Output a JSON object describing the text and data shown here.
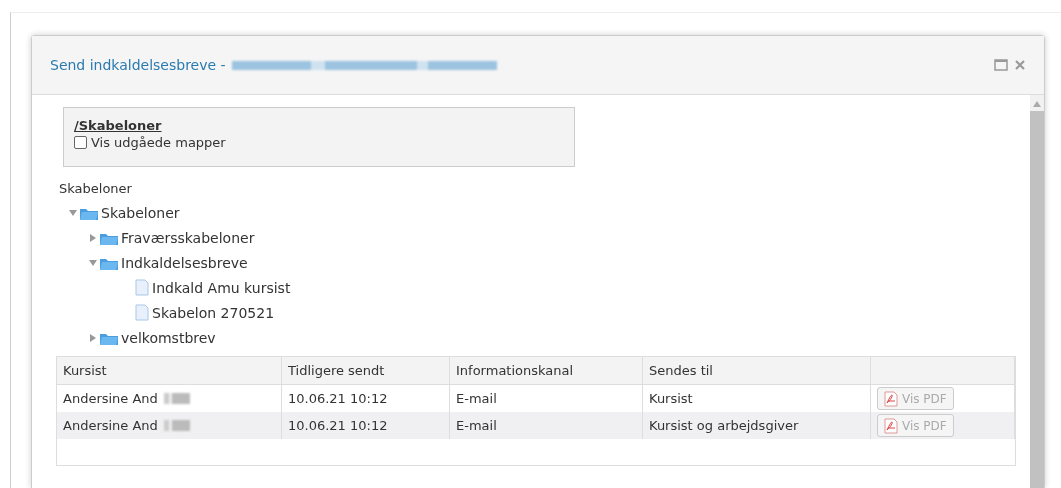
{
  "dialog": {
    "title": "Send indkaldelsesbreve -"
  },
  "breadcrumb": {
    "path": "/Skabeloner",
    "show_expired": {
      "label": "Vis udgåede mapper",
      "checked": false
    }
  },
  "tree": {
    "label": "Skabeloner",
    "items": [
      {
        "kind": "folder",
        "label": "Skabeloner",
        "expanded": true,
        "children": [
          {
            "kind": "folder",
            "label": "Fraværsskabeloner",
            "expanded": false
          },
          {
            "kind": "folder",
            "label": "Indkaldelsesbreve",
            "expanded": true,
            "children": [
              {
                "kind": "file",
                "label": "Indkald Amu kursist"
              },
              {
                "kind": "file",
                "label": "Skabelon 270521"
              }
            ]
          },
          {
            "kind": "folder",
            "label": "velkomstbrev",
            "expanded": false
          }
        ]
      }
    ]
  },
  "table": {
    "columns": [
      "Kursist",
      "Tidligere sendt",
      "Informationskanal",
      "Sendes til"
    ],
    "rows": [
      {
        "cells": [
          "Andersine And",
          "10.06.21 10:12",
          "E-mail",
          "Kursist"
        ],
        "button": {
          "label": "Vis PDF",
          "disabled": true
        }
      },
      {
        "cells": [
          "Andersine And",
          "10.06.21 10:12",
          "E-mail",
          "Kursist og arbejdsgiver"
        ],
        "button": {
          "label": "Vis PDF",
          "disabled": true
        }
      }
    ]
  }
}
